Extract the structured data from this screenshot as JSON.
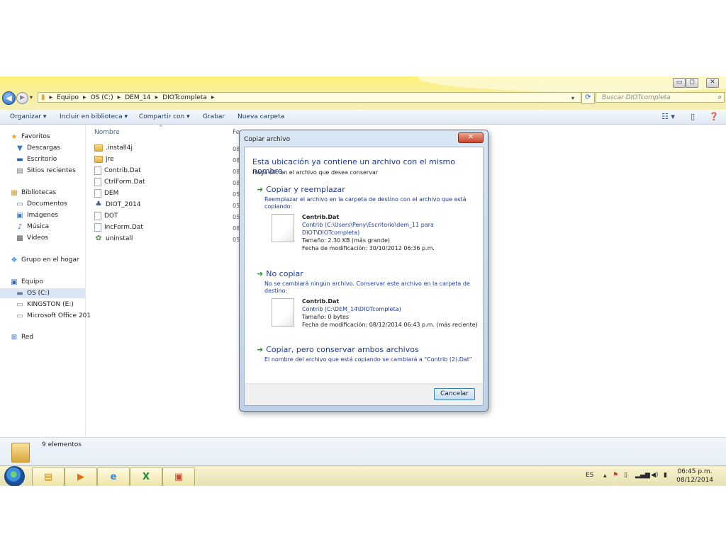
{
  "window": {
    "buttons": {
      "minimize": "▭",
      "maximize": "◻",
      "close": "✕"
    }
  },
  "address": {
    "crumbs": [
      "Equipo",
      "OS (C:)",
      "DEM_14",
      "DIOTcompleta"
    ],
    "search_placeholder": "Buscar DIOTcompleta"
  },
  "toolbar": {
    "organize": "Organizar ▾",
    "library": "Incluir en biblioteca ▾",
    "share": "Compartir con ▾",
    "burn": "Grabar",
    "new_folder": "Nueva carpeta"
  },
  "navpane": {
    "favorites": "Favoritos",
    "downloads": "Descargas",
    "desktop": "Escritorio",
    "recent": "Sitios recientes",
    "libraries": "Bibliotecas",
    "documents": "Documentos",
    "images": "Imágenes",
    "music": "Música",
    "videos": "Vídeos",
    "homegroup": "Grupo en el hogar",
    "computer": "Equipo",
    "drive_c": "OS (C:)",
    "drive_e": "KINGSTON (E:)",
    "office": "Microsoft Office 201",
    "network": "Red"
  },
  "filelist": {
    "col_name": "Nombre",
    "col_date": "Fe",
    "files": [
      {
        "name": ".install4j",
        "date": "08"
      },
      {
        "name": "jre",
        "date": "08"
      },
      {
        "name": "Contrib.Dat",
        "date": "08"
      },
      {
        "name": "CtrlForm.Dat",
        "date": "08"
      },
      {
        "name": "DEM",
        "date": "05"
      },
      {
        "name": "DIOT_2014",
        "date": "05"
      },
      {
        "name": "DOT",
        "date": "05"
      },
      {
        "name": "IncForm.Dat",
        "date": "08"
      },
      {
        "name": "uninstall",
        "date": "05"
      }
    ]
  },
  "status": {
    "count": "9 elementos"
  },
  "dialog": {
    "title": "Copiar archivo",
    "close": "✕",
    "heading": "Esta ubicación ya contiene un archivo con el mismo nombre.",
    "subheading": "Haga clic en el archivo que desea conservar",
    "opt1": {
      "label": "Copiar y reemplazar",
      "desc": "Reemplazar el archivo en la carpeta de destino con el archivo que está copiando:",
      "file_name": "Contrib.Dat",
      "file_path": "Contrib (C:\\Users\\Peny\\Escritorio\\dem_11 para DIOT\\DIOTcompleta)",
      "size": "Tamaño: 2.30 KB (más grande)",
      "modified": "Fecha de modificación: 30/10/2012 06:36 p.m."
    },
    "opt2": {
      "label": "No copiar",
      "desc": "No se cambiará ningún archivo. Conservar este archivo en la carpeta de destino:",
      "file_name": "Contrib.Dat",
      "file_path": "Contrib (C:\\DEM_14\\DIOTcompleta)",
      "size": "Tamaño: 0 bytes",
      "modified": "Fecha de modificación: 08/12/2014 06:43 p.m. (más reciente)"
    },
    "opt3": {
      "label": "Copiar, pero conservar ambos archivos",
      "desc": "El nombre del archivo que está copiando se cambiará a \"Contrib (2).Dat\""
    },
    "cancel": "Cancelar"
  },
  "taskbar": {
    "lang": "ES",
    "time": "06:45 p.m.",
    "date": "08/12/2014"
  },
  "colors": {
    "link": "#1c3a9a",
    "title_yellow": "#fff27a",
    "arrow_green": "#2f9d35"
  }
}
